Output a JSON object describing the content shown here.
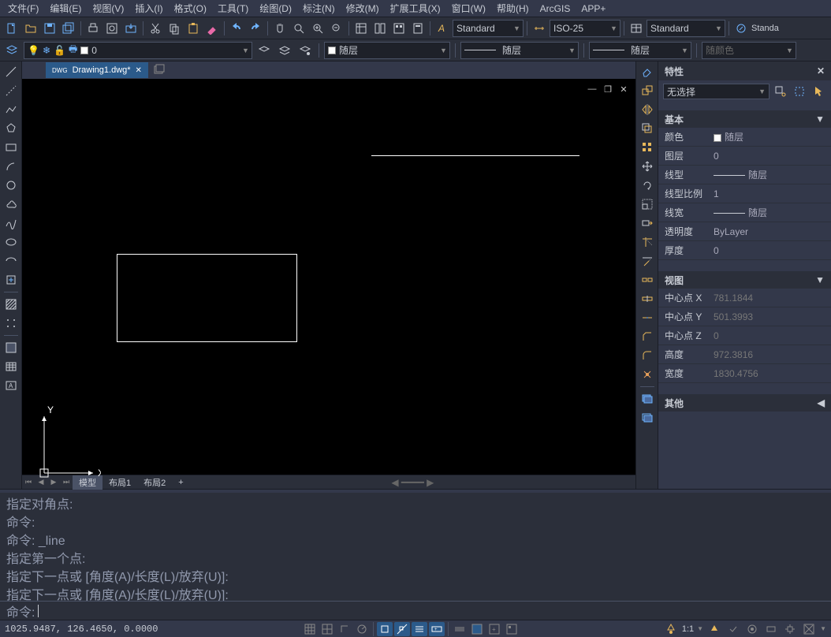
{
  "menu": [
    "文件(F)",
    "编辑(E)",
    "视图(V)",
    "插入(I)",
    "格式(O)",
    "工具(T)",
    "绘图(D)",
    "标注(N)",
    "修改(M)",
    "扩展工具(X)",
    "窗口(W)",
    "帮助(H)",
    "ArcGIS",
    "APP+"
  ],
  "toolbar": {
    "text_style_label": "Standard",
    "dim_style_label": "ISO-25",
    "table_style_label": "Standard",
    "annot_style_label": "Standa"
  },
  "layer_row": {
    "layer_dd": "0",
    "bylayer_dd": "随层",
    "linetype_dd": "随层",
    "lineweight_dd": "随层",
    "color_dd": "随颜色"
  },
  "doc_tab": "Drawing1.dwg*",
  "model_tabs": {
    "model": "模型",
    "layout1": "布局1",
    "layout2": "布局2",
    "add": "+"
  },
  "props": {
    "title": "特性",
    "selector": "无选择",
    "section_basic": "基本",
    "rows_basic": {
      "color_label": "颜色",
      "color_value": "随层",
      "layer_label": "图层",
      "layer_value": "0",
      "linetype_label": "线型",
      "linetype_value": "随层",
      "ltscale_label": "线型比例",
      "ltscale_value": "1",
      "lineweight_label": "线宽",
      "lineweight_value": "随层",
      "transp_label": "透明度",
      "transp_value": "ByLayer",
      "thick_label": "厚度",
      "thick_value": "0"
    },
    "section_view": "视图",
    "rows_view": {
      "cx_label": "中心点 X",
      "cx_value": "781.1844",
      "cy_label": "中心点 Y",
      "cy_value": "501.3993",
      "cz_label": "中心点 Z",
      "cz_value": "0",
      "h_label": "高度",
      "h_value": "972.3816",
      "w_label": "宽度",
      "w_value": "1830.4756"
    },
    "section_other": "其他"
  },
  "cmd": {
    "history": [
      "指定对角点:",
      "命令:",
      "命令: _line",
      "指定第一个点:",
      "指定下一点或 [角度(A)/长度(L)/放弃(U)]:",
      "指定下一点或 [角度(A)/长度(L)/放弃(U)]:"
    ],
    "prompt": "命令:"
  },
  "status": {
    "coords": "1025.9487, 126.4650, 0.0000",
    "scale_label": "1:1"
  },
  "ucs": {
    "x": "X",
    "y": "Y"
  }
}
